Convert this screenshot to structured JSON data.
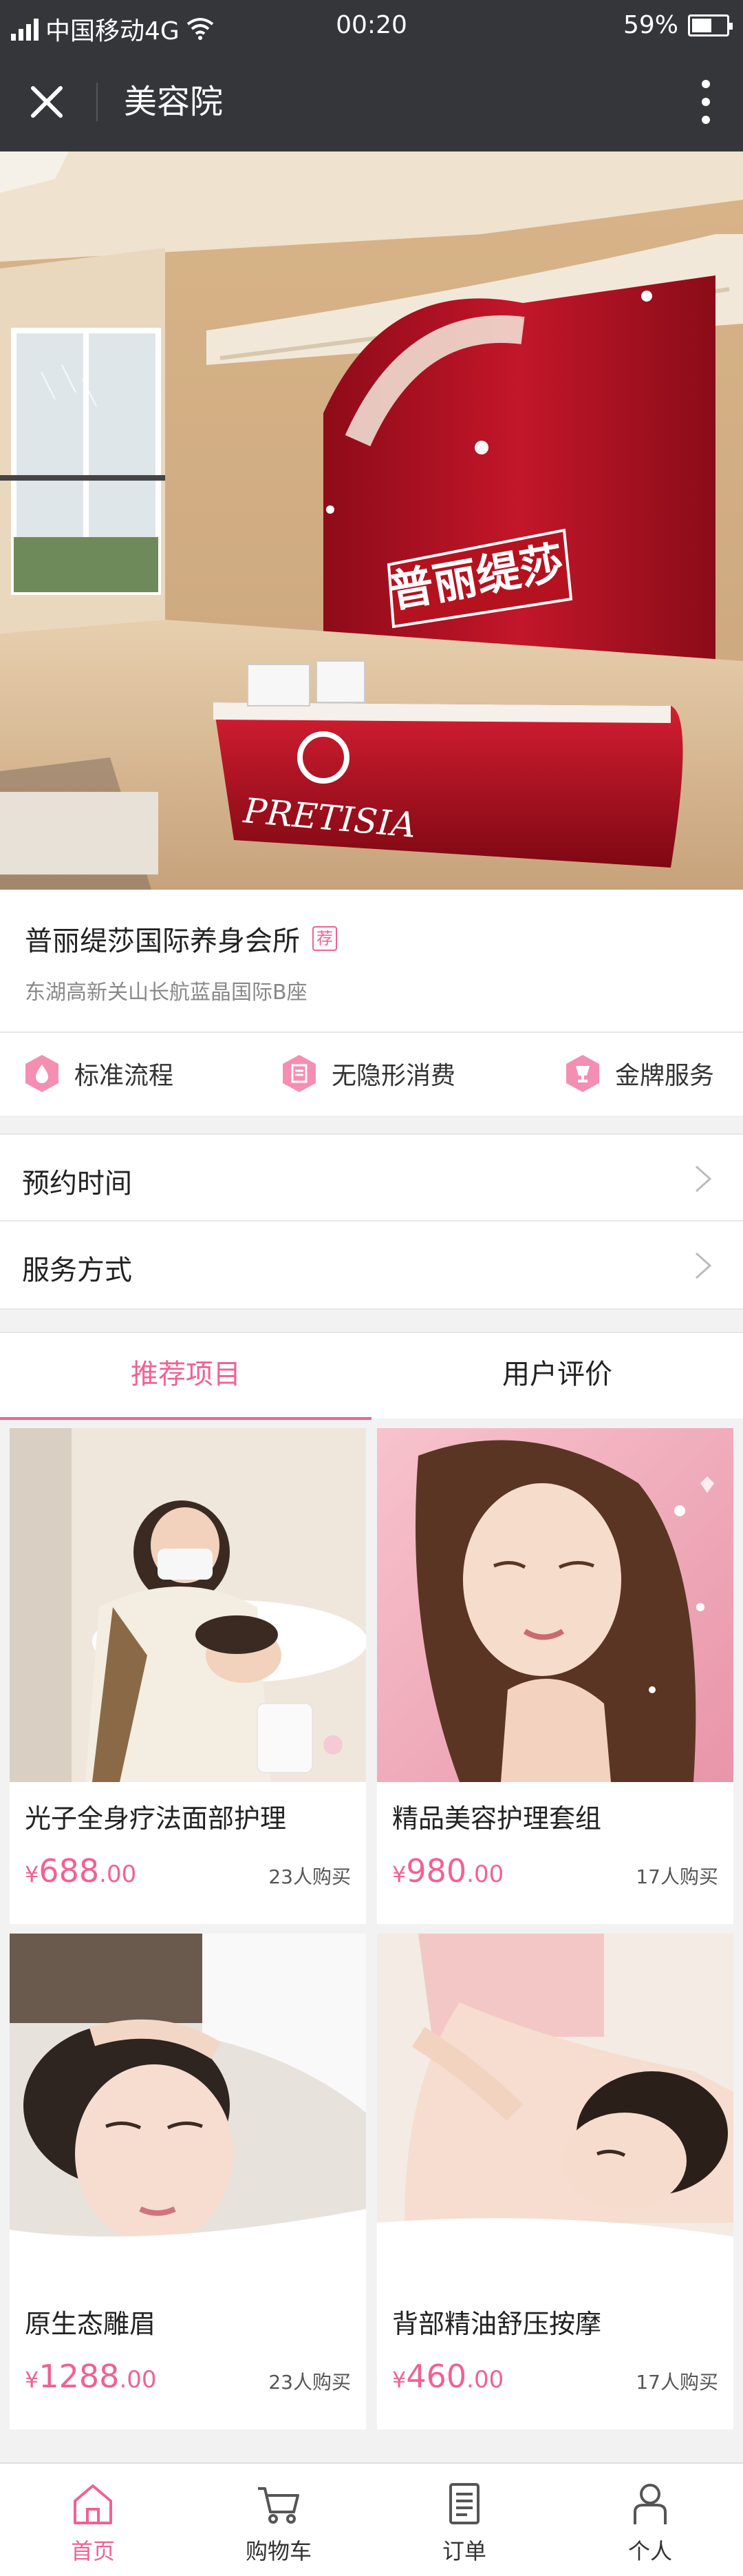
{
  "status_bar": {
    "carrier": "中国移动4G",
    "time": "00:20",
    "battery": "59%",
    "battery_level": 0.59
  },
  "header": {
    "title": "美容院"
  },
  "store": {
    "name": "普丽缇莎国际养身会所",
    "tag": "荐",
    "address": "东湖高新关山长航蓝晶国际B座"
  },
  "features": [
    {
      "label": "标准流程",
      "icon": "droplet-icon"
    },
    {
      "label": "无隐形消费",
      "icon": "receipt-icon"
    },
    {
      "label": "金牌服务",
      "icon": "trophy-icon"
    }
  ],
  "options": [
    {
      "label": "预约时间"
    },
    {
      "label": "服务方式"
    }
  ],
  "tabs": [
    {
      "label": "推荐项目",
      "active": true
    },
    {
      "label": "用户评价",
      "active": false
    }
  ],
  "products": [
    {
      "name": "光子全身疗法面部护理",
      "currency": "¥",
      "price_int": "688",
      "price_dec": ".00",
      "sold": "23人购买"
    },
    {
      "name": "精品美容护理套组",
      "currency": "¥",
      "price_int": "980",
      "price_dec": ".00",
      "sold": "17人购买"
    },
    {
      "name": "原生态雕眉",
      "currency": "¥",
      "price_int": "1288",
      "price_dec": ".00",
      "sold": "23人购买"
    },
    {
      "name": "背部精油舒压按摩",
      "currency": "¥",
      "price_int": "460",
      "price_dec": ".00",
      "sold": "17人购买"
    }
  ],
  "bottom_nav": [
    {
      "label": "首页",
      "icon": "home-icon",
      "active": true
    },
    {
      "label": "购物车",
      "icon": "cart-icon",
      "active": false
    },
    {
      "label": "订单",
      "icon": "order-icon",
      "active": false
    },
    {
      "label": "个人",
      "icon": "person-icon",
      "active": false
    }
  ],
  "hero_logo": {
    "cn": "普丽缇莎",
    "en": "PRETISIA"
  },
  "colors": {
    "accent": "#f06292",
    "header_bg": "#35363a",
    "brand_red": "#b01020"
  }
}
